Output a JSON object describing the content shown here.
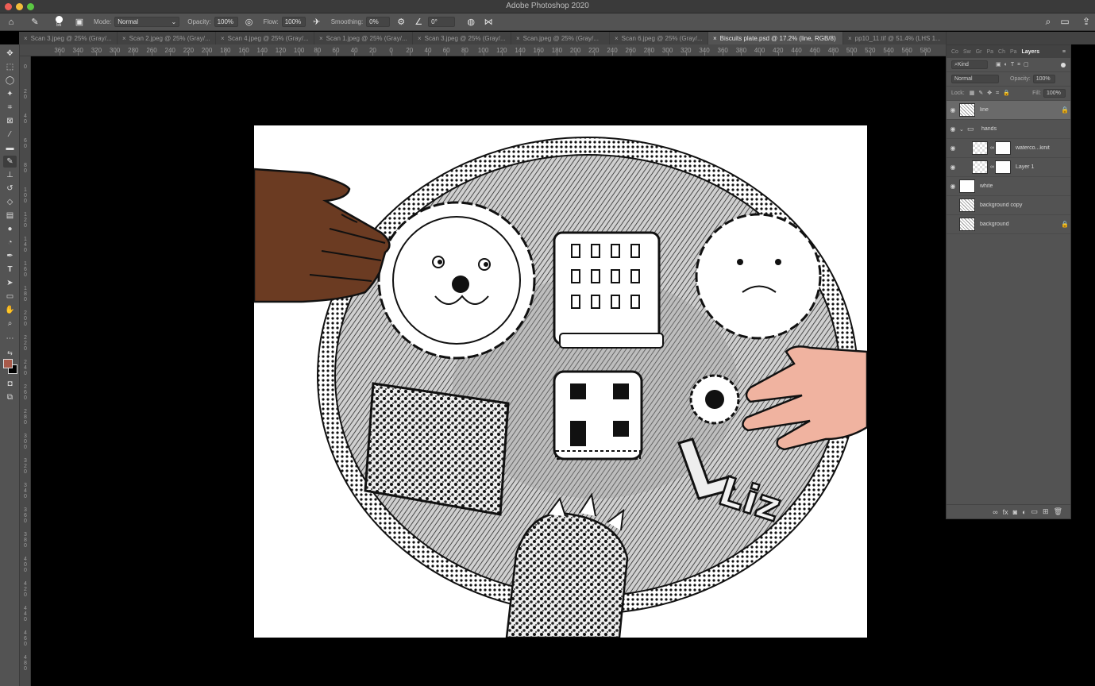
{
  "app": {
    "title": "Adobe Photoshop 2020"
  },
  "options_bar": {
    "brush_size": "56",
    "mode_label": "Mode:",
    "mode_value": "Normal",
    "opacity_label": "Opacity:",
    "opacity_value": "100%",
    "flow_label": "Flow:",
    "flow_value": "100%",
    "smoothing_label": "Smoothing:",
    "smoothing_value": "0%",
    "angle_value": "0°"
  },
  "tabs": [
    {
      "label": "Scan 3.jpeg @ 25% (Gray/..."
    },
    {
      "label": "Scan 2.jpeg @ 25% (Gray/..."
    },
    {
      "label": "Scan 4.jpeg @ 25% (Gray/..."
    },
    {
      "label": "Scan 1.jpeg @ 25% (Gray/..."
    },
    {
      "label": "Scan 3.jpeg @ 25% (Gray/..."
    },
    {
      "label": "Scan.jpeg @ 25% (Gray/..."
    },
    {
      "label": "Scan 6.jpeg @ 25% (Gray/..."
    },
    {
      "label": "Biscuits plate.psd @ 17.2% (line, RGB/8)"
    },
    {
      "label": "pp10_11.tif @ 51.4% (LHS 1..."
    }
  ],
  "ruler_h": [
    "360",
    "340",
    "320",
    "300",
    "280",
    "260",
    "240",
    "220",
    "200",
    "180",
    "160",
    "140",
    "120",
    "100",
    "80",
    "60",
    "40",
    "20",
    "0",
    "20",
    "40",
    "60",
    "80",
    "100",
    "120",
    "140",
    "160",
    "180",
    "200",
    "220",
    "240",
    "260",
    "280",
    "300",
    "320",
    "340",
    "360",
    "380",
    "400",
    "420",
    "440",
    "460",
    "480",
    "500",
    "520",
    "540",
    "560",
    "580",
    "600"
  ],
  "ruler_v_ticks": [
    "0",
    "20",
    "40",
    "60",
    "80",
    "100",
    "120",
    "140",
    "160",
    "180",
    "200",
    "220",
    "240",
    "260",
    "280",
    "300",
    "320",
    "340",
    "360",
    "380",
    "400",
    "420",
    "440",
    "460",
    "480",
    "500"
  ],
  "colors": {
    "foreground": "#a85a4a",
    "background": "#000000"
  },
  "layers_panel": {
    "tabs": [
      {
        "label": "Co"
      },
      {
        "label": "Sw"
      },
      {
        "label": "Gr"
      },
      {
        "label": "Pa"
      },
      {
        "label": "Ch"
      },
      {
        "label": "Pa"
      },
      {
        "label": "Layers"
      }
    ],
    "filter_value": "Kind",
    "blend_mode": "Normal",
    "opacity_label": "Opacity:",
    "opacity_value": "100%",
    "lock_label": "Lock:",
    "fill_label": "Fill:",
    "fill_value": "100%",
    "layers": [
      {
        "name": "line",
        "thumb": "sketch",
        "selected": true,
        "locked": true,
        "visible": true,
        "indent": 0
      },
      {
        "name": "hands",
        "thumb": "folder",
        "selected": false,
        "locked": false,
        "visible": true,
        "indent": 0
      },
      {
        "name": "waterco...kinit",
        "thumb": "check",
        "selected": false,
        "locked": false,
        "visible": true,
        "indent": 1
      },
      {
        "name": "Layer 1",
        "thumb": "check",
        "selected": false,
        "locked": false,
        "visible": true,
        "indent": 1
      },
      {
        "name": "white",
        "thumb": "white",
        "selected": false,
        "locked": false,
        "visible": true,
        "indent": 0
      },
      {
        "name": "background copy",
        "thumb": "sketch",
        "selected": false,
        "locked": false,
        "visible": false,
        "indent": 0
      },
      {
        "name": "background",
        "thumb": "sketch",
        "selected": false,
        "locked": true,
        "visible": false,
        "indent": 0
      }
    ]
  },
  "artwork": {
    "text": "Liz"
  }
}
